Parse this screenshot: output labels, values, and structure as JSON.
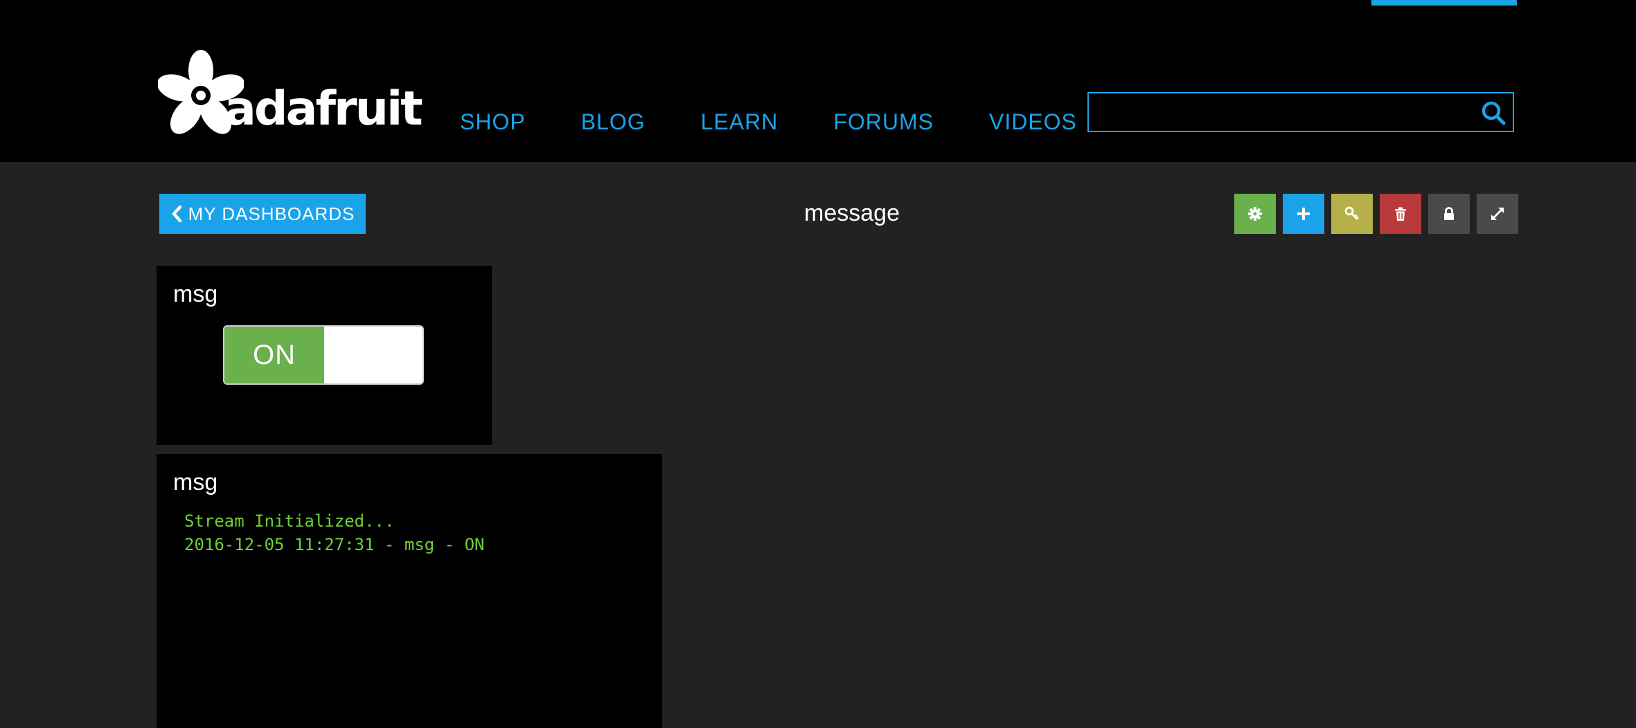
{
  "header": {
    "logo_text": "adafruit",
    "nav": [
      {
        "label": "SHOP"
      },
      {
        "label": "BLOG"
      },
      {
        "label": "LEARN"
      },
      {
        "label": "FORUMS"
      },
      {
        "label": "VIDEOS"
      }
    ],
    "search": {
      "value": "",
      "placeholder": ""
    },
    "search_icon": "search-icon",
    "accent_color": "#1aa3e8"
  },
  "toolbar": {
    "back_label": "MY DASHBOARDS",
    "title": "message",
    "buttons": [
      {
        "name": "settings",
        "icon": "gear-icon",
        "color": "#6ab04c"
      },
      {
        "name": "add",
        "icon": "plus-icon",
        "color": "#1aa3e8"
      },
      {
        "name": "key",
        "icon": "key-icon",
        "color": "#b5b04a"
      },
      {
        "name": "delete",
        "icon": "trash-icon",
        "color": "#b83a3a"
      },
      {
        "name": "lock",
        "icon": "lock-icon",
        "color": "#4a4a4a"
      },
      {
        "name": "fullscreen",
        "icon": "expand-icon",
        "color": "#4a4a4a"
      }
    ]
  },
  "blocks": {
    "toggle": {
      "title": "msg",
      "state_label": "ON",
      "on_color": "#6ab04c"
    },
    "stream": {
      "title": "msg",
      "lines": [
        "Stream Initialized...",
        "2016-12-05 11:27:31 - msg - ON"
      ],
      "text_color": "#6fd036"
    }
  }
}
